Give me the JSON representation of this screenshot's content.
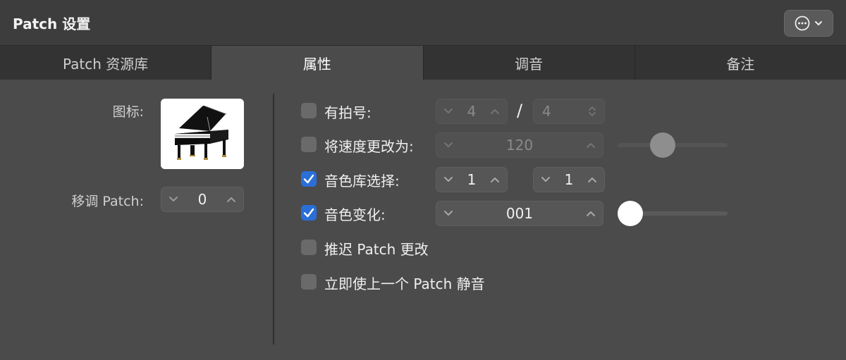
{
  "window": {
    "title": "Patch 设置",
    "more_menu_icon": "ellipsis-circle-icon"
  },
  "tabs": [
    {
      "label": "Patch 资源库",
      "active": false
    },
    {
      "label": "属性",
      "active": true
    },
    {
      "label": "调音",
      "active": false
    },
    {
      "label": "备注",
      "active": false
    }
  ],
  "left": {
    "icon_label": "图标:",
    "icon_image": "grand-piano-icon",
    "transpose_label": "移调 Patch:",
    "transpose_value": "0"
  },
  "options": {
    "time_signature": {
      "label": "有拍号:",
      "checked": false,
      "numerator": "4",
      "separator": "/",
      "denominator": "4"
    },
    "tempo": {
      "label": "将速度更改为:",
      "checked": false,
      "value": "120"
    },
    "bank_select": {
      "label": "音色库选择:",
      "checked": true,
      "msb": "1",
      "lsb": "1"
    },
    "program_change": {
      "label": "音色变化:",
      "checked": true,
      "value": "001"
    },
    "delay_patch_change": {
      "label": "推迟 Patch 更改",
      "checked": false
    },
    "mute_previous_patch": {
      "label": "立即使上一个 Patch 静音",
      "checked": false
    }
  },
  "colors": {
    "accent": "#2a6fd8",
    "background": "#4b4b4b"
  }
}
